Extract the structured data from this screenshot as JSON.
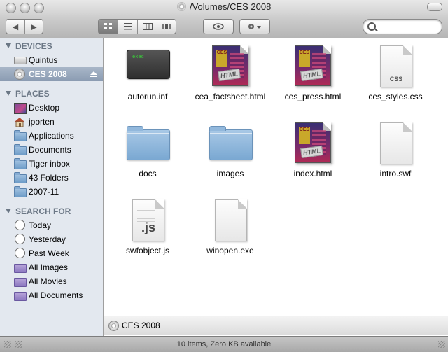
{
  "window": {
    "title": "/Volumes/CES 2008"
  },
  "toolbar": {
    "back_glyph": "◀",
    "forward_glyph": "▶",
    "view_modes": [
      "icon-view",
      "list-view",
      "column-view",
      "coverflow-view"
    ],
    "active_view": "icon-view",
    "quicklook_glyph": "👁",
    "action_glyph": "⚙▾",
    "search_placeholder": ""
  },
  "sidebar": {
    "devices": {
      "header": "DEVICES",
      "items": [
        {
          "label": "Quintus",
          "icon": "hard-drive-icon"
        },
        {
          "label": "CES 2008",
          "icon": "disk-icon",
          "selected": true,
          "eject": true
        }
      ]
    },
    "places": {
      "header": "PLACES",
      "items": [
        {
          "label": "Desktop",
          "icon": "desktop-icon"
        },
        {
          "label": "jporten",
          "icon": "home-icon"
        },
        {
          "label": "Applications",
          "icon": "folder-icon"
        },
        {
          "label": "Documents",
          "icon": "folder-icon"
        },
        {
          "label": "Tiger inbox",
          "icon": "folder-icon"
        },
        {
          "label": "43 Folders",
          "icon": "folder-icon"
        },
        {
          "label": "2007-11",
          "icon": "folder-icon"
        }
      ]
    },
    "search_for": {
      "header": "SEARCH FOR",
      "items": [
        {
          "label": "Today",
          "icon": "clock-icon"
        },
        {
          "label": "Yesterday",
          "icon": "clock-icon"
        },
        {
          "label": "Past Week",
          "icon": "clock-icon"
        },
        {
          "label": "All Images",
          "icon": "smart-folder-icon"
        },
        {
          "label": "All Movies",
          "icon": "smart-folder-icon"
        },
        {
          "label": "All Documents",
          "icon": "smart-folder-icon"
        }
      ]
    }
  },
  "files": [
    {
      "name": "autorun.inf",
      "icon": "executable-icon",
      "badge": "exec"
    },
    {
      "name": "cea_factsheet.html",
      "icon": "html-icon",
      "badge": "HTML",
      "art": "CES"
    },
    {
      "name": "ces_press.html",
      "icon": "html-icon",
      "badge": "HTML",
      "art": "CES"
    },
    {
      "name": "ces_styles.css",
      "icon": "css-file-icon",
      "badge": "CSS"
    },
    {
      "name": "docs",
      "icon": "folder-icon"
    },
    {
      "name": "images",
      "icon": "folder-icon"
    },
    {
      "name": "index.html",
      "icon": "html-icon",
      "badge": "HTML",
      "art": "CES"
    },
    {
      "name": "intro.swf",
      "icon": "swf-file-icon"
    },
    {
      "name": "swfobject.js",
      "icon": "js-file-icon",
      "badge": ".js"
    },
    {
      "name": "winopen.exe",
      "icon": "exe-file-icon"
    }
  ],
  "pathbar": {
    "label": "CES 2008"
  },
  "status": {
    "text": "10 items, Zero KB available"
  }
}
